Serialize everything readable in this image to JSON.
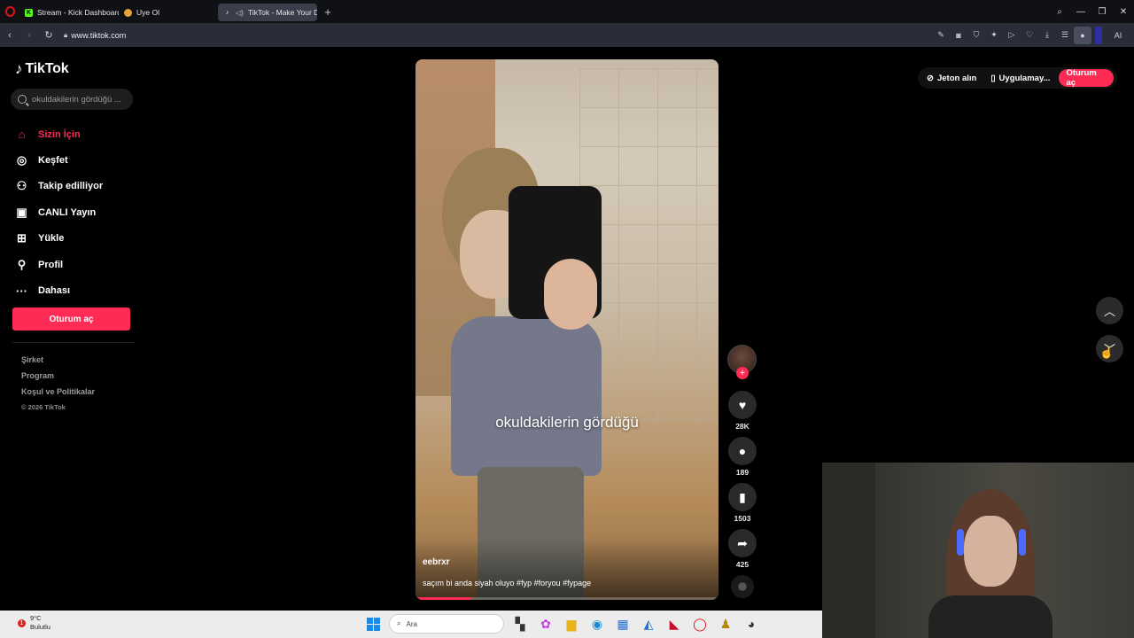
{
  "browser": {
    "tabs": [
      {
        "label": "Stream - Kick Dashboard",
        "icon": "kick-icon",
        "color": "#53fc18"
      },
      {
        "label": "Uye Ol",
        "icon": "globe-icon",
        "color": "#e6a23c"
      },
      {
        "label": "TikTok - Make Your Day",
        "icon": "tiktok-icon",
        "color": "#ffffff"
      }
    ],
    "url": "www.tiktok.com",
    "ai_label": "AI"
  },
  "sidebar": {
    "logo_text": "TikTok",
    "search_value": "okuldakilerin gördüğü ...",
    "items": [
      {
        "label": "Sizin İçin",
        "icon": "home-icon"
      },
      {
        "label": "Keşfet",
        "icon": "compass-icon"
      },
      {
        "label": "Takip edilliyor",
        "icon": "following-icon"
      },
      {
        "label": "CANLI Yayın",
        "icon": "live-icon"
      },
      {
        "label": "Yükle",
        "icon": "upload-icon"
      },
      {
        "label": "Profil",
        "icon": "profile-icon"
      },
      {
        "label": "Dahası",
        "icon": "more-icon"
      }
    ],
    "login_label": "Oturum aç",
    "footer": {
      "company": "Şirket",
      "program": "Program",
      "terms": "Koşul ve Politikalar",
      "copyright": "© 2026 TikTok"
    }
  },
  "video": {
    "overlay_text": "okuldakilerin gördüğü",
    "author": "eebrxr",
    "caption": "saçım bi anda siyah oluyo #fyp #foryou #fypage",
    "progress": 0.18
  },
  "actions": {
    "likes": "28K",
    "comments": "189",
    "saves": "1503",
    "shares": "425"
  },
  "top_right": {
    "coins": "Jeton alın",
    "app": "Uygulamay...",
    "login": "Oturum aç"
  },
  "taskbar": {
    "temp": "9°C",
    "weather": "Bulutlu",
    "badge": "1",
    "search_placeholder": "Ara"
  },
  "colors": {
    "accent": "#fe2c55",
    "background": "#000000"
  }
}
